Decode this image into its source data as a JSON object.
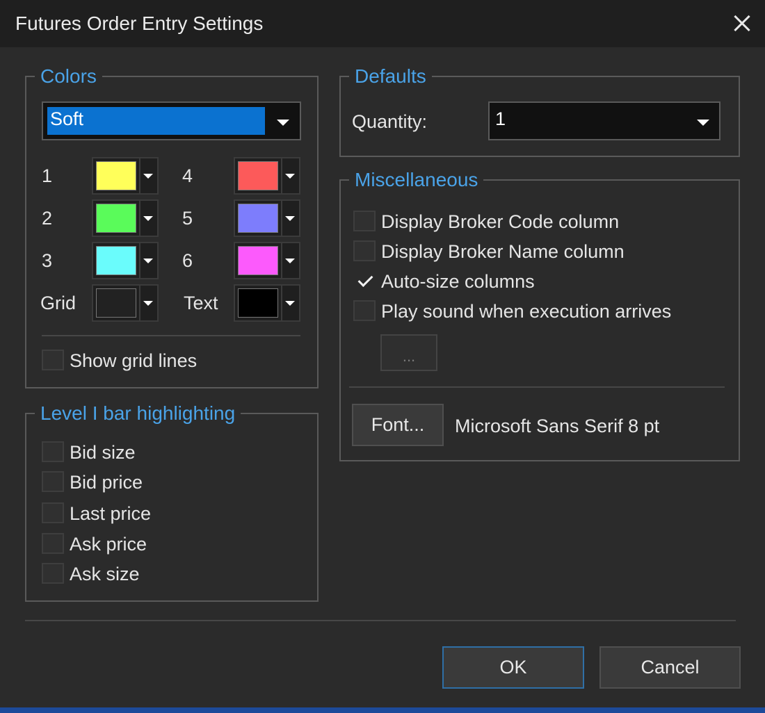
{
  "window": {
    "title": "Futures Order Entry Settings"
  },
  "colors": {
    "legend": "Colors",
    "scheme": "Soft",
    "swatches": [
      {
        "label": "1",
        "color": "#ffff5a"
      },
      {
        "label": "2",
        "color": "#5afb5a"
      },
      {
        "label": "3",
        "color": "#6afcfc"
      },
      {
        "label": "4",
        "color": "#fc5a5a"
      },
      {
        "label": "5",
        "color": "#7d7dfc"
      },
      {
        "label": "6",
        "color": "#fc5afc"
      },
      {
        "label": "Grid",
        "color": "#222222"
      },
      {
        "label": "Text",
        "color": "#000000"
      }
    ],
    "show_grid_lines": {
      "label": "Show grid lines",
      "checked": false
    }
  },
  "level1": {
    "legend": "Level I bar highlighting",
    "items": [
      {
        "label": "Bid size",
        "checked": false
      },
      {
        "label": "Bid price",
        "checked": false
      },
      {
        "label": "Last price",
        "checked": false
      },
      {
        "label": "Ask price",
        "checked": false
      },
      {
        "label": "Ask size",
        "checked": false
      }
    ]
  },
  "defaults": {
    "legend": "Defaults",
    "quantity_label": "Quantity:",
    "quantity_value": "1"
  },
  "misc": {
    "legend": "Miscellaneous",
    "items": [
      {
        "label": "Display Broker Code column",
        "checked": false
      },
      {
        "label": "Display Broker Name column",
        "checked": false
      },
      {
        "label": "Auto-size columns",
        "checked": true
      },
      {
        "label": "Play sound when execution arrives",
        "checked": false
      }
    ],
    "browse_label": "...",
    "font_button": "Font...",
    "font_value": "Microsoft Sans Serif 8 pt"
  },
  "buttons": {
    "ok": "OK",
    "cancel": "Cancel"
  }
}
